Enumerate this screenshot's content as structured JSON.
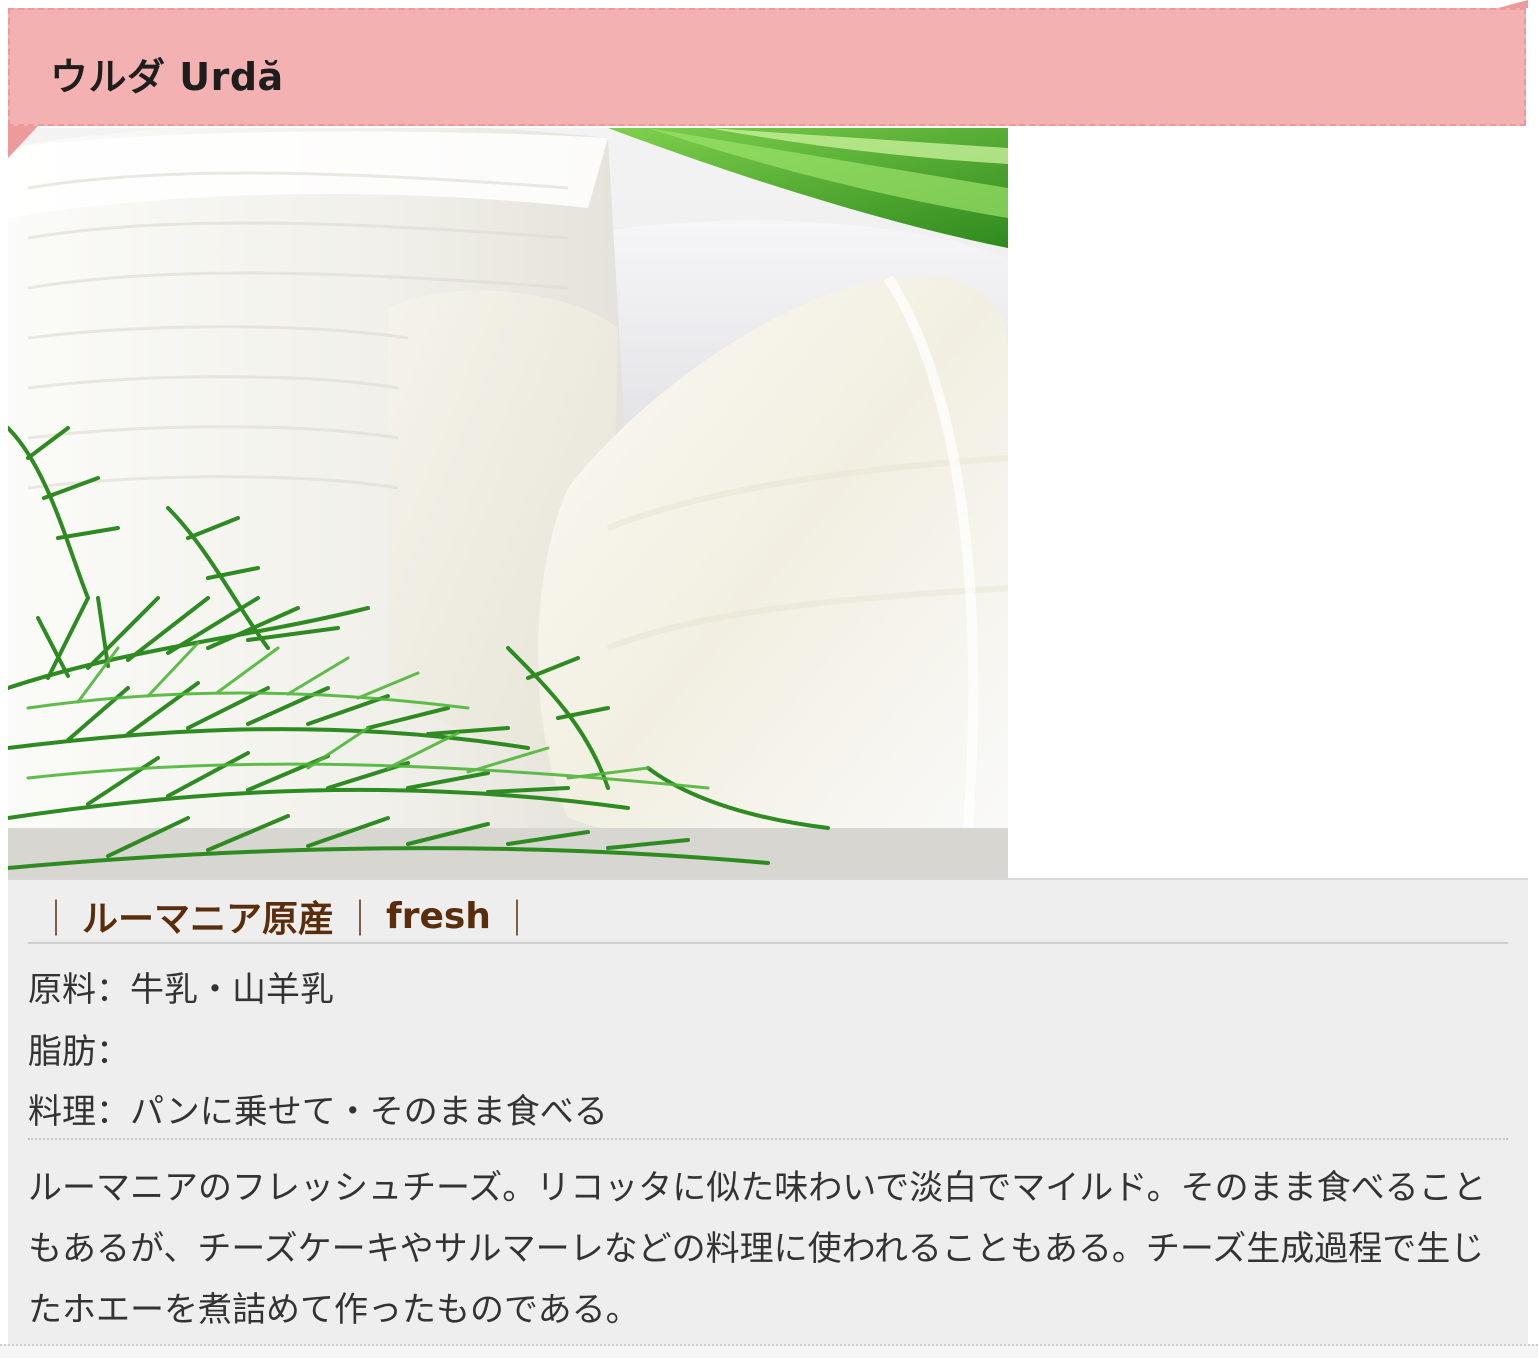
{
  "cheese": {
    "title": "ウルダ Urdă",
    "image_alt": "ウルダ",
    "tags": {
      "sep": "｜",
      "origin": "ルーマニア原産",
      "type": "fresh"
    },
    "specs": {
      "milk_label": "原料：",
      "milk_value": "牛乳・山羊乳",
      "fat_label": "脂肪：",
      "fat_value": "",
      "dish_label": "料理：",
      "dish_value": "パンに乗せて・そのまま食べる"
    },
    "description": "ルーマニアのフレッシュチーズ。リコッタに似た味わいで淡白でマイルド。そのまま食べることもあるが、チーズケーキやサルマーレなどの料理に使われることもある。チーズ生成過程で生じたホエーを煮詰めて作ったものである。"
  },
  "colors": {
    "ribbon": "#f4b1b1",
    "ribbon_border": "#eb9a9a",
    "tag_text": "#5a2d0c",
    "panel": "#eeeeee"
  }
}
